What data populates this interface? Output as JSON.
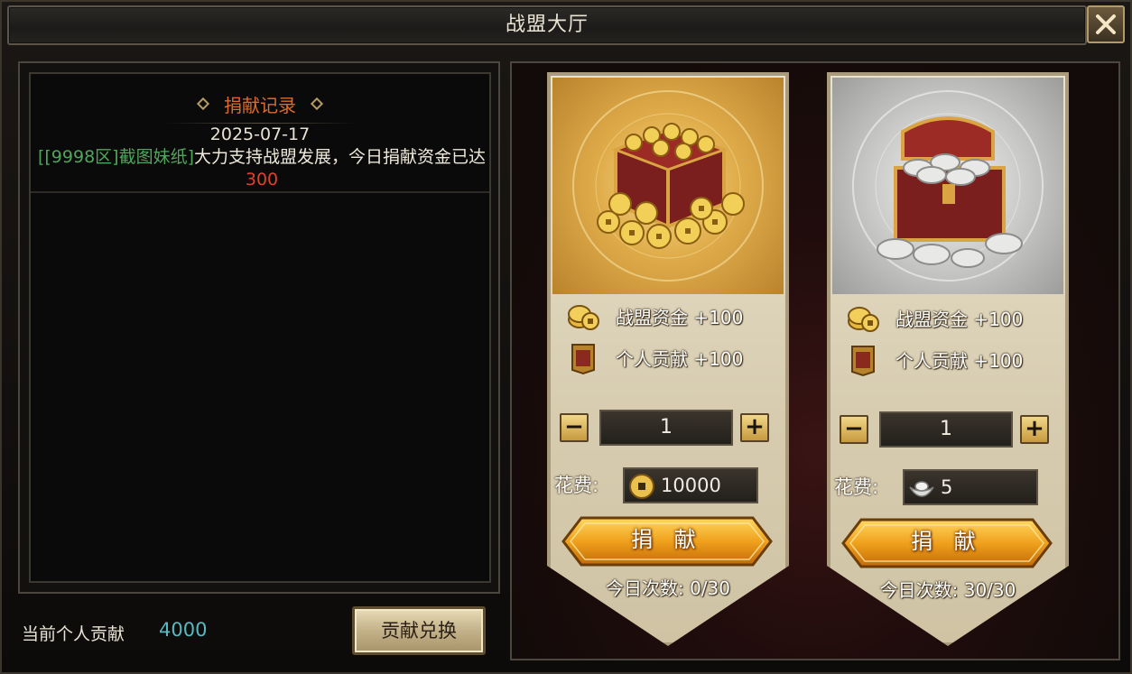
{
  "window": {
    "title": "战盟大厅"
  },
  "records": {
    "header": "捐献记录",
    "entries": [
      {
        "date": "2025-07-17",
        "player": "[[9998区]截图妹纸]",
        "message": "大力支持战盟发展，今日捐献资金已达",
        "amount": "300"
      }
    ]
  },
  "footer": {
    "contribution_label": "当前个人贡献",
    "contribution_value": "4000",
    "exchange_button": "贡献兑换"
  },
  "donations": [
    {
      "kind": "gold",
      "fund_label": "战盟资金 +100",
      "personal_label": "个人贡献 +100",
      "quantity": "1",
      "cost_label": "花费:",
      "cost_value": "10000",
      "cost_icon": "coin-icon",
      "donate_label": "捐 献",
      "daily_label": "今日次数: 0/30"
    },
    {
      "kind": "silver",
      "fund_label": "战盟资金 +100",
      "personal_label": "个人贡献 +100",
      "quantity": "1",
      "cost_label": "花费:",
      "cost_value": "5",
      "cost_icon": "silver-ingot-icon",
      "donate_label": "捐 献",
      "daily_label": "今日次数: 30/30"
    }
  ],
  "icon_badge_char": "贡",
  "colors": {
    "player_name": "#4fa65a",
    "amount": "#e2402e",
    "record_header": "#e06a28",
    "contribution_value": "#57b9c2"
  }
}
